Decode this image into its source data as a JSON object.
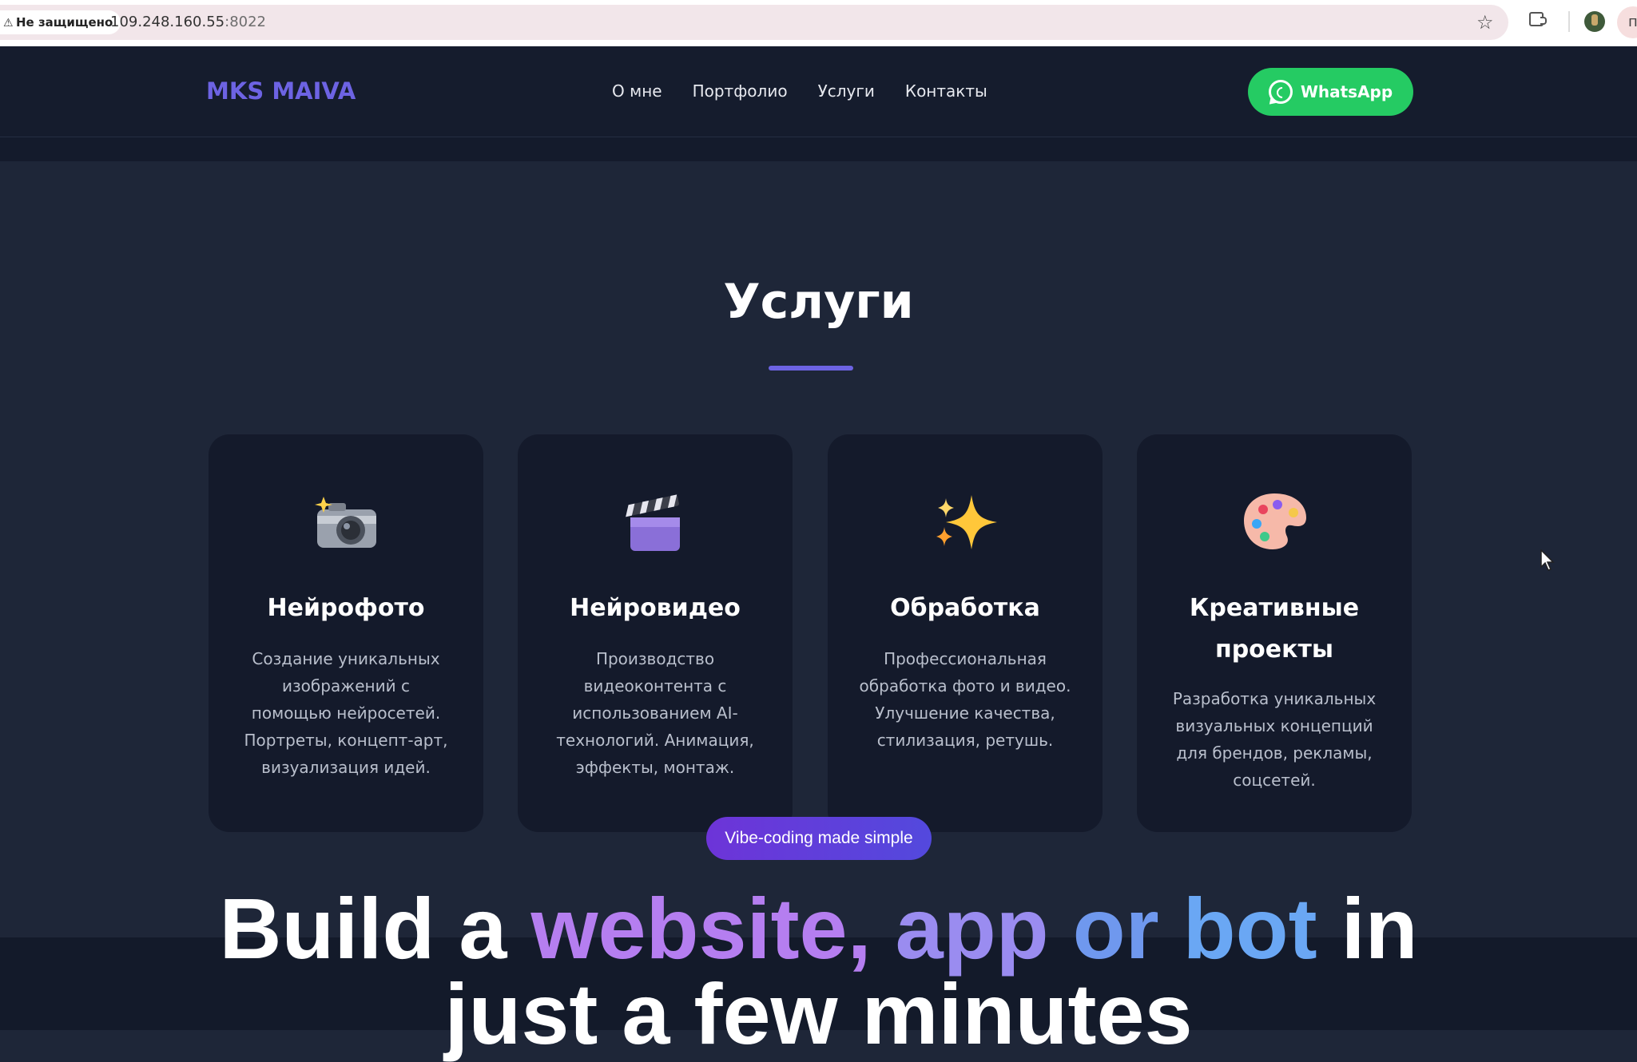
{
  "browser": {
    "security_label": "Не защищено",
    "url_host": "109.248.160.55",
    "url_port": ":8022"
  },
  "header": {
    "logo": "MKS MAIVA",
    "nav": [
      "О мне",
      "Портфолио",
      "Услуги",
      "Контакты"
    ],
    "whatsapp_label": "WhatsApp"
  },
  "services": {
    "title": "Услуги",
    "cards": [
      {
        "icon": "camera-icon",
        "title": "Нейрофото",
        "desc_lines": [
          "Создание уникальных",
          "изображений с",
          "помощью нейросетей.",
          "Портреты, концепт-арт,",
          "визуализация идей."
        ]
      },
      {
        "icon": "clapperboard-icon",
        "title": "Нейровидео",
        "desc_lines": [
          "Производство",
          "видеоконтента с",
          "использованием AI-",
          "технологий. Анимация,",
          "эффекты, монтаж."
        ]
      },
      {
        "icon": "sparkles-icon",
        "title": "Обработка",
        "desc_lines": [
          "Профессиональная",
          "обработка фото и видео.",
          "Улучшение качества,",
          "стилизация, ретушь."
        ]
      },
      {
        "icon": "palette-icon",
        "title_lines": [
          "Креативные",
          "проекты"
        ],
        "desc_lines": [
          "Разработка уникальных",
          "визуальных концепций",
          "для брендов, рекламы,",
          "соцсетей."
        ]
      }
    ]
  },
  "overlay": {
    "pill": "Vibe-coding made simple",
    "headline": {
      "part1": "Build a ",
      "g1": "website,",
      "g2": " app",
      "g3": " or",
      "g4": " bot",
      "part2": " in"
    },
    "headline_line2": "just a few minutes"
  },
  "colors": {
    "accent": "#6d63e3",
    "whatsapp": "#25cb63",
    "background": "#1e2638",
    "card": "#141a2b"
  }
}
